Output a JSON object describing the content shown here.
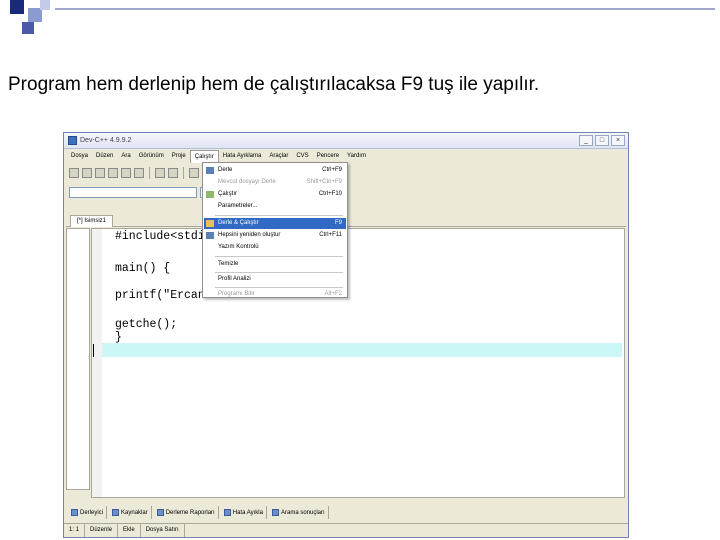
{
  "slide": {
    "title": "Program hem derlenip hem de çalıştırılacaksa F9 tuş ile yapılır."
  },
  "window": {
    "title": "Dev-C++ 4.9.9.2",
    "buttons": [
      "_",
      "□",
      "×"
    ]
  },
  "menubar": {
    "items": [
      "Dosya",
      "Düzen",
      "Ara",
      "Görünüm",
      "Proje",
      "Çalıştır",
      "Hata Ayıklama",
      "Araçlar",
      "CVS",
      "Pencere",
      "Yardım"
    ]
  },
  "file_tab": "[*] Isimsiz1",
  "code": {
    "lines": [
      "#include<stdio",
      "main() {",
      "printf(\"Ercan",
      "getche();",
      "}"
    ]
  },
  "run_menu": {
    "items": [
      {
        "label": "Derle",
        "shortcut": "Ctrl+F9"
      },
      {
        "label": "Mevcut dosyayı Derle",
        "shortcut": "Shift+Ctrl+F9"
      },
      {
        "label": "Çalıştır",
        "shortcut": "Ctrl+F10"
      },
      {
        "label": "Parametreler...",
        "shortcut": ""
      },
      {
        "label": "Derle & Çalıştır",
        "shortcut": "F9"
      },
      {
        "label": "Hepsini yeniden oluştur",
        "shortcut": "Ctrl+F11"
      },
      {
        "label": "Yazım Kontrolü",
        "shortcut": ""
      },
      {
        "label": "Temizle",
        "shortcut": ""
      },
      {
        "label": "Profil Analizi",
        "shortcut": ""
      },
      {
        "label": "Programı Bitir",
        "shortcut": "Alt+F2"
      }
    ]
  },
  "bottom_tabs": [
    "Derleyici",
    "Kaynaklar",
    "Derleme Raporları",
    "Hata Ayıkla",
    "Arama sonuçları"
  ],
  "status": [
    "1: 1",
    "Düzenle",
    "Ekle",
    "Dosya Satırı"
  ],
  "colors": {
    "menu_selection": "#316ac5",
    "current_line": "#ccf7f7",
    "window_border": "#6f84b5"
  }
}
